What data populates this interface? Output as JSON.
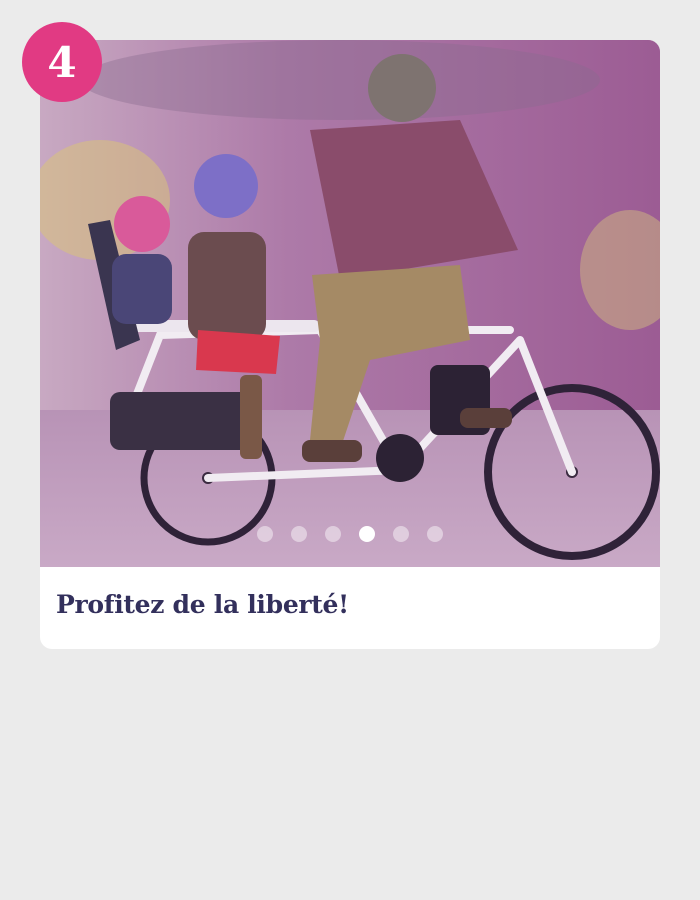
{
  "step": {
    "number": "4",
    "color": "#e13a83"
  },
  "slideshow": {
    "caption": "Profitez de la liberté!",
    "total_slides": 6,
    "active_slide": 4,
    "image_icon": "family-cargo-bike-photo"
  },
  "colors": {
    "caption": "#33305c",
    "background": "#ebebeb",
    "card": "#ffffff"
  }
}
